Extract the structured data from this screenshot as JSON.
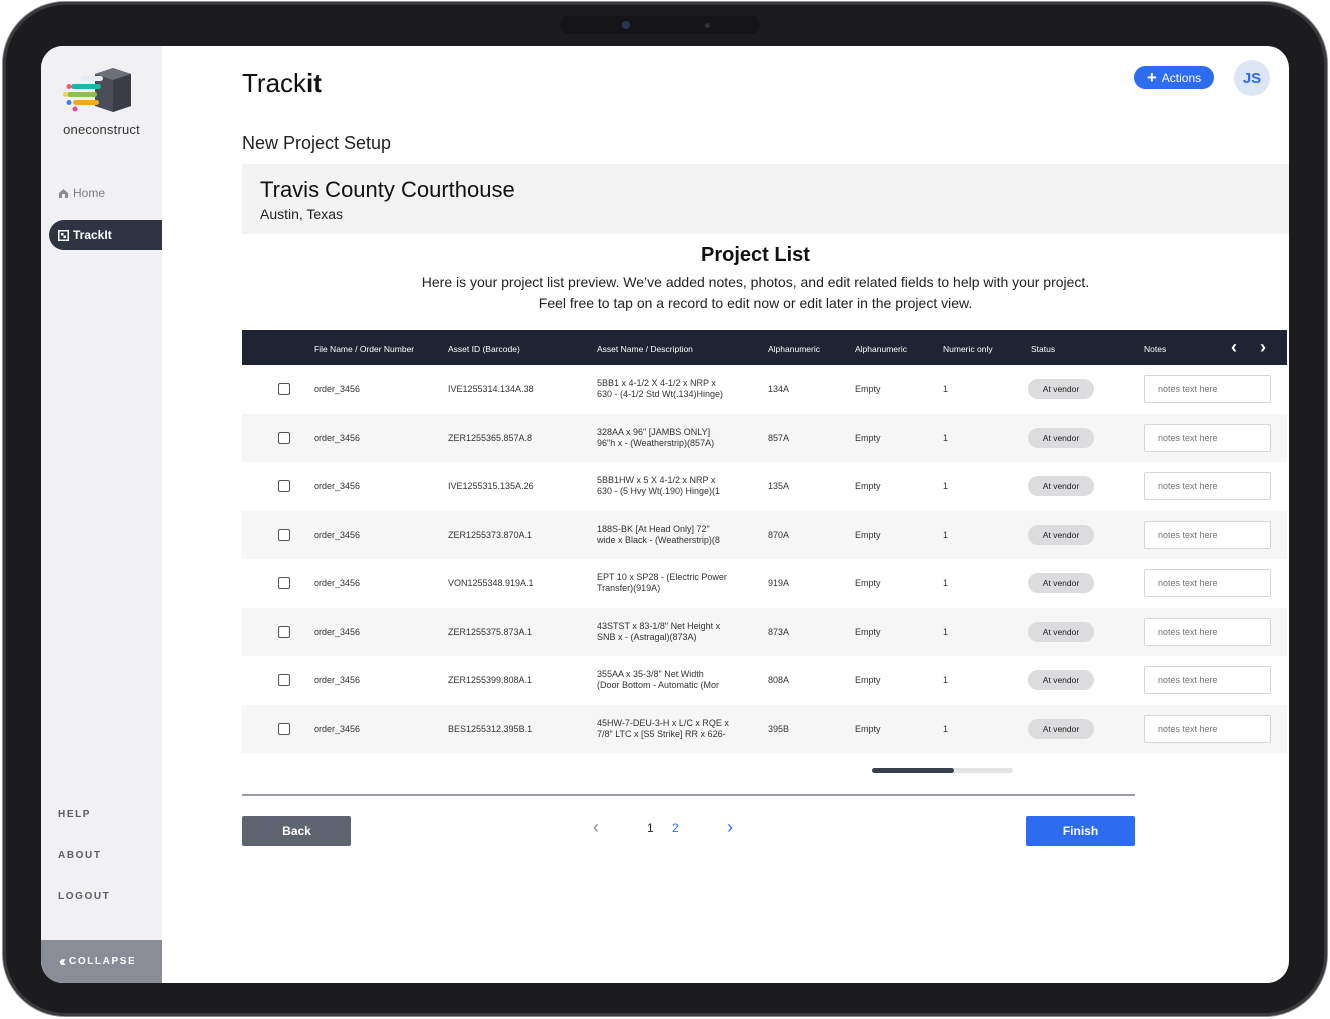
{
  "app": {
    "title_prefix": "Track",
    "title_suffix": "it",
    "actions_label": "Actions",
    "avatar_initials": "JS"
  },
  "sidebar": {
    "logo_text": "oneconstruct",
    "nav": [
      {
        "label": "Home",
        "icon": "home-icon"
      },
      {
        "label": "TrackIt",
        "icon": "trackit-icon"
      }
    ],
    "links": [
      "HELP",
      "ABOUT",
      "LOGOUT"
    ],
    "collapse_label": "COLLAPSE"
  },
  "page": {
    "setup_title": "New Project Setup",
    "project_name": "Travis County Courthouse",
    "project_location": "Austin, Texas",
    "list_title": "Project List",
    "list_desc_line1": "Here is your project list preview. We’ve added notes, photos, and edit related fields to help with your project.",
    "list_desc_line2": "Feel free to tap on a record to edit now or edit later in the project view."
  },
  "table": {
    "headers": [
      "File Name / Order Number",
      "Asset ID (Barcode)",
      "Asset Name / Description",
      "Alphanumeric",
      "Alphanumeric",
      "Numeric only",
      "Status",
      "Notes"
    ],
    "notes_placeholder": "notes text here",
    "rows": [
      {
        "file": "order_3456",
        "asset_id": "IVE1255314.134A.38",
        "desc1": "5BB1 x 4-1/2 X 4-1/2 x NRP x",
        "desc2": "630 - (4-1/2 Std Wt(.134)Hinge)",
        "alpha1": "134A",
        "alpha2": "Empty",
        "num": "1",
        "status": "At vendor"
      },
      {
        "file": "order_3456",
        "asset_id": "ZER1255365.857A.8",
        "desc1": "328AA x 96\" [JAMBS ONLY]",
        "desc2": "96\"h x - (Weatherstrip)(857A)",
        "alpha1": "857A",
        "alpha2": "Empty",
        "num": "1",
        "status": "At vendor"
      },
      {
        "file": "order_3456",
        "asset_id": "IVE1255315.135A.26",
        "desc1": "5BB1HW x 5 X 4-1/2 x NRP x",
        "desc2": "630 - (5 Hvy Wt(.190) Hinge)(1",
        "alpha1": "135A",
        "alpha2": "Empty",
        "num": "1",
        "status": "At vendor"
      },
      {
        "file": "order_3456",
        "asset_id": "ZER1255373.870A.1",
        "desc1": "188S-BK [At Head Only] 72\"",
        "desc2": "wide x Black - (Weatherstrip)(8",
        "alpha1": "870A",
        "alpha2": "Empty",
        "num": "1",
        "status": "At vendor"
      },
      {
        "file": "order_3456",
        "asset_id": "VON1255348.919A.1",
        "desc1": "EPT 10 x SP28 - (Electric Power",
        "desc2": "Transfer)(919A)",
        "alpha1": "919A",
        "alpha2": "Empty",
        "num": "1",
        "status": "At vendor"
      },
      {
        "file": "order_3456",
        "asset_id": "ZER1255375.873A.1",
        "desc1": "43STST x 83-1/8\" Net Height x",
        "desc2": "SNB x - (Astragal)(873A)",
        "alpha1": "873A",
        "alpha2": "Empty",
        "num": "1",
        "status": "At vendor"
      },
      {
        "file": "order_3456",
        "asset_id": "ZER1255399.808A.1",
        "desc1": "355AA x 35-3/8\" Net Width",
        "desc2": "(Door Bottom - Automatic (Mor",
        "alpha1": "808A",
        "alpha2": "Empty",
        "num": "1",
        "status": "At vendor"
      },
      {
        "file": "order_3456",
        "asset_id": "BES1255312.395B.1",
        "desc1": "45HW-7-DEU-3-H x L/C x RQE x",
        "desc2": "7/8\" LTC x [S5 Strike] RR x 626-",
        "alpha1": "395B",
        "alpha2": "Empty",
        "num": "1",
        "status": "At vendor"
      }
    ]
  },
  "footer": {
    "back_label": "Back",
    "finish_label": "Finish",
    "pages": [
      "1",
      "2"
    ],
    "current_page": "1"
  },
  "colors": {
    "accent": "#2d6cf0",
    "table_header": "#1e2433",
    "sidebar_active": "#2e3442",
    "sidebar_bg": "#f1f1f3"
  }
}
